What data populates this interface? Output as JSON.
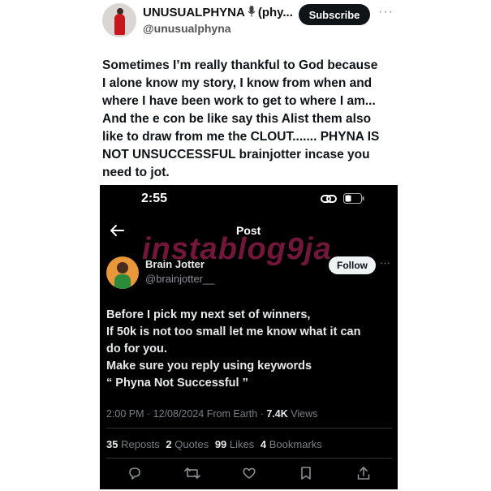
{
  "outer_post": {
    "display_name": "UNUSUALPHYNA",
    "display_name_suffix": "(phy...",
    "handle": "@unusualphyna",
    "subscribe_label": "Subscribe",
    "more_label": "···",
    "text_lines": [
      "Sometimes I’m really thankful to God because",
      "I alone know my story, I know from when and",
      "where I have been work to get to where I am...",
      "And the e con be like say this Alist them also",
      "like to draw from me the CLOUT....... PHYNA IS",
      "NOT UNSUCCESSFUL  brainjotter incase you",
      "need to jot."
    ]
  },
  "embedded_screenshot": {
    "status_time": "2:55",
    "header_title": "Post",
    "watermark": "instablog9ja",
    "author": {
      "name": "Brain Jotter",
      "handle": "@brainjotter__",
      "follow_label": "Follow",
      "more_label": "···"
    },
    "tweet_lines": [
      "Before  I pick my next set of winners,",
      "If 50k is not too small let me know what it can",
      "do for you.",
      "Make sure you reply using keywords",
      "“ Phyna Not Successful ”"
    ],
    "meta": {
      "time": "2:00 PM",
      "date": "12/08/2024",
      "source": "From Earth",
      "views_count": "7.4K",
      "views_label": "Views"
    },
    "stats": {
      "reposts_count": "35",
      "reposts_label": "Reposts",
      "quotes_count": "2",
      "quotes_label": "Quotes",
      "likes_count": "99",
      "likes_label": "Likes",
      "bookmarks_count": "4",
      "bookmarks_label": "Bookmarks"
    },
    "icons": [
      "link-icon",
      "battery-icon",
      "back-arrow-icon",
      "reply-icon",
      "repost-icon",
      "like-icon",
      "bookmark-icon",
      "share-icon"
    ]
  },
  "colors": {
    "subscribe_bg": "#0f1419",
    "phone_bg": "#000000",
    "watermark": "#d2286e",
    "jotter_avatar": "#e8983a"
  }
}
